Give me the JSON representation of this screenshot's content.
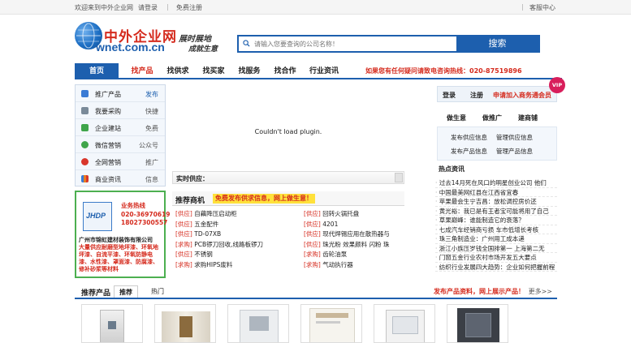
{
  "topbar": {
    "welcome": "欢迎来到中外企业网",
    "login": "请登录",
    "sep1": "|",
    "register": "免费注册",
    "sep2": "|",
    "service": "客服中心"
  },
  "logo": {
    "cn": "中外企业网",
    "en": "wnet.com.cn",
    "slogan_line1": "展时展地",
    "slogan_line2": "成就生意"
  },
  "search": {
    "placeholder": "请输入您要查询的公司名称！",
    "button": "搜索"
  },
  "nav": {
    "items": [
      {
        "label": "首页"
      },
      {
        "label": "找产品"
      },
      {
        "label": "找供求"
      },
      {
        "label": "找买家"
      },
      {
        "label": "找服务"
      },
      {
        "label": "找合作"
      },
      {
        "label": "行业资讯"
      }
    ],
    "hotline": "如果您有任何疑问请致电咨询热线：020-87519896"
  },
  "sidebar": {
    "items": [
      {
        "label": "推广产品",
        "right": "发布",
        "icon": "product-icon",
        "color": "#3a7bd5"
      },
      {
        "label": "我要采购",
        "right": "快捷",
        "icon": "cart-icon",
        "color": "#7a8a99"
      },
      {
        "label": "企业建站",
        "right": "免费",
        "icon": "site-icon",
        "color": "#3fa54a"
      },
      {
        "label": "微信营销",
        "right": "公众号",
        "icon": "wechat-icon",
        "color": "#3fa54a"
      },
      {
        "label": "全网营销",
        "right": "推广",
        "icon": "network-icon",
        "color": "#d9362b"
      },
      {
        "label": "商业资讯",
        "right": "信息",
        "icon": "chart-icon",
        "color": "#e67e22"
      }
    ]
  },
  "ad": {
    "logo_text": "JHDP",
    "hotline_label": "业务热线",
    "phone1": "020-36970619",
    "phone2": "18027300557",
    "company": "广州市锦虹建材装饰有限公司",
    "desc": "大量供应耐磨型地坪漆、环氧地坪漆、自流平漆、环氧防静电漆、水性漆、罩面漆、防腐漆、修补砂浆等材料"
  },
  "plugin": {
    "message": "Couldn't load plugin."
  },
  "live": {
    "label": "实时供应："
  },
  "recommend": {
    "title": "推荐商机",
    "banner": "免费发布供求信息，网上做生意！",
    "left": [
      {
        "tag": "[供应]",
        "text": "自藕降压启动柜"
      },
      {
        "tag": "[供应]",
        "text": "五金配件"
      },
      {
        "tag": "[供应]",
        "text": "TD-07XB"
      },
      {
        "tag": "[求购]",
        "text": "PCB锣刀回收,线路板锣刀"
      },
      {
        "tag": "[供应]",
        "text": "不锈钢"
      },
      {
        "tag": "[求购]",
        "text": "求购HIPS废料"
      }
    ],
    "right": [
      {
        "tag": "[供应]",
        "text": "回转火锅托盘"
      },
      {
        "tag": "[供应]",
        "text": "4201"
      },
      {
        "tag": "[供应]",
        "text": "现代焊锡应用在散热器与"
      },
      {
        "tag": "[供应]",
        "text": "珠光粉 效果颜料 闪粉 珠"
      },
      {
        "tag": "[求购]",
        "text": "齿轮油泵"
      },
      {
        "tag": "[求购]",
        "text": "气动执行器"
      }
    ]
  },
  "right": {
    "login": "登录",
    "register": "注册",
    "apply": "申请加入商务通会员",
    "vip": "VIP",
    "tabs": [
      {
        "label": "做生意"
      },
      {
        "label": "做推广"
      },
      {
        "label": "建商铺"
      }
    ],
    "links": [
      {
        "label": "发布供应信息"
      },
      {
        "label": "管理供应信息"
      },
      {
        "label": "发布产品信息"
      },
      {
        "label": "管理产品信息"
      }
    ],
    "hot_title": "热点资讯",
    "hot_items": [
      "过去14月死在风口的明星创业公司 他们",
      "中国最美网红县在江西省宜春",
      "苹果最会生宁吉昌：放松调控房价还",
      "黄光裕：我已是有王者宝可能将用了自己",
      "草果巅峰：谁能制造它的衰落？",
      "七成汽车经销商亏损 车市低增长考核",
      "珠三角制造业：广州用工成本递",
      "浙江小族压岁钱全国排第一 上海第二无",
      "门窗五金行业农村市场开发五大要点",
      "纺织行业发展四大趋势：企业如何把握前程"
    ]
  },
  "products": {
    "title": "推荐产品",
    "tab1": "推荐",
    "tab2": "热门",
    "promo": "发布产品资料，网上展示产品！",
    "more": "更多>>"
  },
  "colors": {
    "brand_blue": "#1d5fae",
    "accent_red": "#d52b1e",
    "vip_pink": "#d81e5b",
    "ad_green": "#4caf50"
  }
}
